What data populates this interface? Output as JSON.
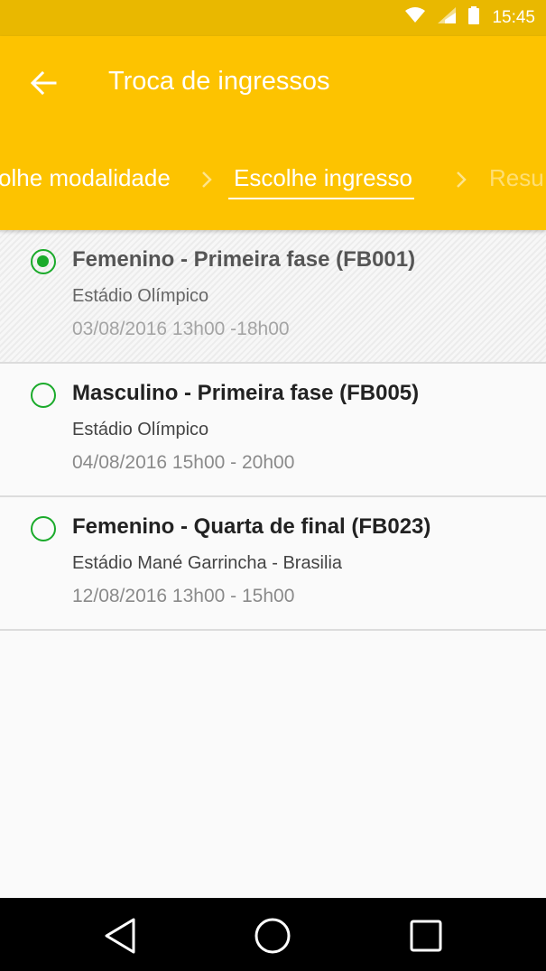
{
  "status_bar": {
    "time": "15:45",
    "icons": [
      "wifi-icon",
      "cell-signal-icon",
      "battery-icon"
    ]
  },
  "app_bar": {
    "title": "Troca de ingressos",
    "background_color": "#fdc300",
    "status_color": "#e9b800"
  },
  "stepper": {
    "steps": [
      {
        "label": "olhe modalidade",
        "state": "done"
      },
      {
        "label": "Escolhe ingresso",
        "state": "active"
      },
      {
        "label": "Resu",
        "state": "upcoming"
      }
    ]
  },
  "tickets": [
    {
      "title": "Femenino - Primeira fase (FB001)",
      "venue": "Estádio Olímpico",
      "time": "03/08/2016 13h00 -18h00",
      "selected": true
    },
    {
      "title": "Masculino - Primeira fase (FB005)",
      "venue": "Estádio Olímpico",
      "time": "04/08/2016 15h00 - 20h00",
      "selected": false
    },
    {
      "title": "Femenino - Quarta de final (FB023)",
      "venue": "Estádio Mané Garrincha - Brasilia",
      "time": "12/08/2016 13h00 - 15h00",
      "selected": false
    }
  ],
  "accent_color": "#1aaa2a",
  "nav_bar": {
    "icons": [
      "back-triangle-icon",
      "home-circle-icon",
      "recents-square-icon"
    ]
  }
}
